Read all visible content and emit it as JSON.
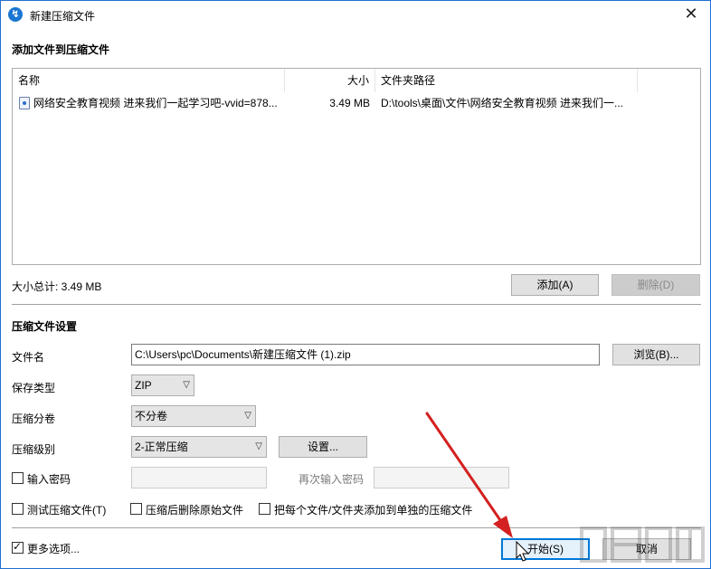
{
  "window": {
    "title": "新建压缩文件",
    "close_glyph": "✕"
  },
  "add_section": {
    "title": "添加文件到压缩文件",
    "columns": {
      "name": "名称",
      "size": "大小",
      "path": "文件夹路径"
    },
    "files": [
      {
        "name": "网络安全教育视频 进来我们一起学习吧-vvid=878...",
        "size": "3.49 MB",
        "path": "D:\\tools\\桌面\\文件\\网络安全教育视频 进来我们一..."
      }
    ],
    "total_label": "大小总计: 3.49 MB",
    "add_button": "添加(A)",
    "delete_button": "删除(D)"
  },
  "settings": {
    "title": "压缩文件设置",
    "filename_label": "文件名",
    "filename_value": "C:\\Users\\pc\\Documents\\新建压缩文件 (1).zip",
    "browse_button": "浏览(B)...",
    "type_label": "保存类型",
    "type_value": "ZIP",
    "split_label": "压缩分卷",
    "split_value": "不分卷",
    "level_label": "压缩级别",
    "level_value": "2-正常压缩",
    "level_settings_button": "设置...",
    "password_label": "输入密码",
    "password_repeat_label": "再次输入密码",
    "test_label": "测试压缩文件(T)",
    "delete_after_label": "压缩后删除原始文件",
    "separate_label": "把每个文件/文件夹添加到单独的压缩文件",
    "more_options_label": "更多选项..."
  },
  "footer": {
    "start_button": "开始(S)",
    "cancel_button": "取消"
  },
  "icons": {
    "app": "app-logo-icon",
    "file": "video-file-icon",
    "arrow": "red-arrow-annotation",
    "cursor": "mouse-cursor-icon"
  },
  "colors": {
    "accent": "#0078d7",
    "arrow": "#d42020"
  }
}
